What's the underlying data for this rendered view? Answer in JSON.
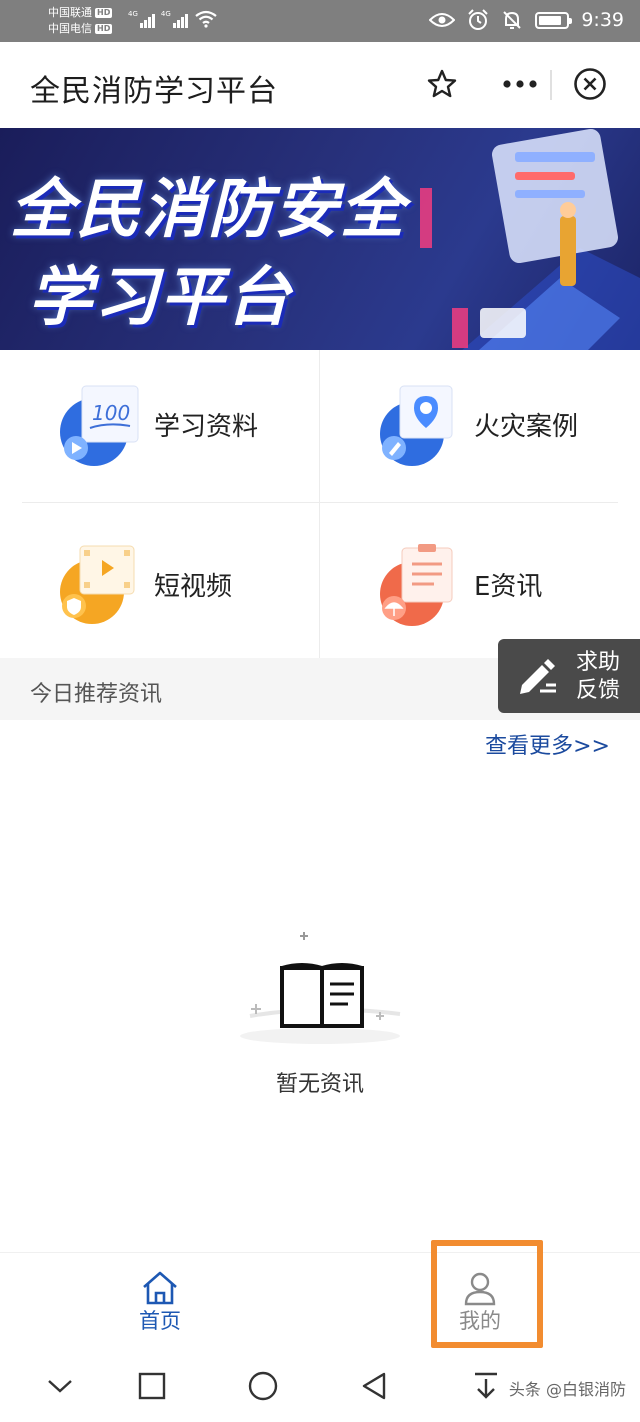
{
  "status_bar": {
    "carrier1": "中国联通",
    "carrier2": "中国电信",
    "hd_label": "HD",
    "network_label": "4G",
    "time": "9:39",
    "battery_level": 0.85
  },
  "title_bar": {
    "title": "全民消防学习平台",
    "icons": [
      "star-icon",
      "more-icon",
      "close-icon"
    ]
  },
  "banner": {
    "line1": "全民消防安全",
    "line2": "学习平台"
  },
  "menu": {
    "items": [
      {
        "label": "学习资料",
        "icon": "study-materials-icon"
      },
      {
        "label": "火灾案例",
        "icon": "fire-case-icon"
      },
      {
        "label": "短视频",
        "icon": "short-video-icon"
      },
      {
        "label": "E资讯",
        "icon": "e-news-icon"
      }
    ]
  },
  "help": {
    "label_line1": "求助",
    "label_line2": "反馈"
  },
  "recommend": {
    "title": "今日推荐资讯",
    "more_link": "查看更多>>",
    "empty_text": "暂无资讯"
  },
  "tab_bar": {
    "tabs": [
      {
        "label": "首页",
        "icon": "home-icon",
        "active": true
      },
      {
        "label": "我的",
        "icon": "user-icon",
        "active": false
      }
    ],
    "active_color": "#1d58b3",
    "highlight_color": "#f28c30"
  },
  "watermark": "头条 @白银消防",
  "colors": {
    "status_bg": "#7f7f7f",
    "banner_bg": "#27307a",
    "help_bg": "#4a4a4a",
    "link": "#1b4a9e"
  }
}
